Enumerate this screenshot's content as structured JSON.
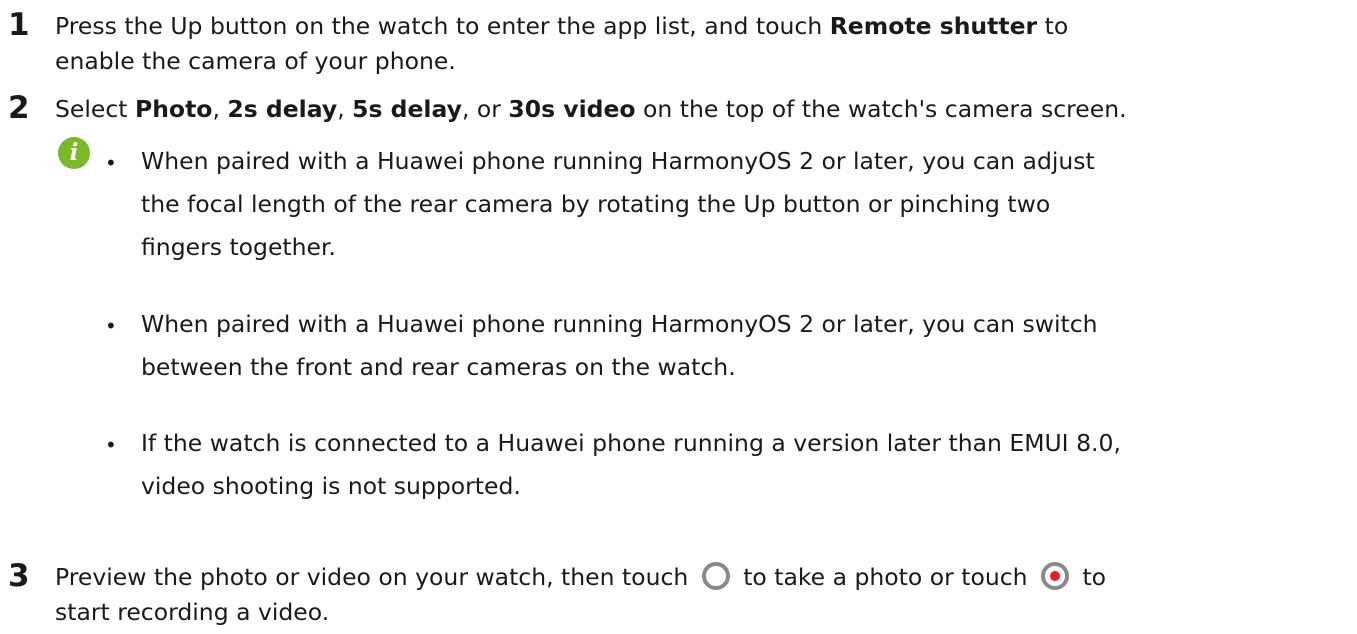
{
  "steps": [
    {
      "number": "1",
      "line1_a": "Press the Up button on the watch to enter the app list, and touch ",
      "line1_bold": "Remote shutter",
      "line1_b": " to",
      "line2": "enable the camera of your phone."
    },
    {
      "number": "2",
      "t1": "Select ",
      "b1": "Photo",
      "t2": ", ",
      "b2": "2s delay",
      "t3": ", ",
      "b3": "5s delay",
      "t4": ", or ",
      "b4": "30s video",
      "t5": " on the top of the watch's camera screen."
    },
    {
      "number": "3",
      "t1": "Preview the photo or video on your watch, then touch ",
      "t2": " to take a photo or touch ",
      "t3": " to",
      "line2": "start recording a video."
    }
  ],
  "note": {
    "icon_glyph": "i",
    "bullets": [
      {
        "line1": "When paired with a Huawei phone running HarmonyOS 2 or later, you can adjust",
        "line2": "the focal length of the rear camera by rotating the Up button or pinching two",
        "line3": "fingers together."
      },
      {
        "line1": "When paired with a Huawei phone running HarmonyOS 2 or later, you can switch",
        "line2": "between the front and rear cameras on the watch."
      },
      {
        "line1": "If the watch is connected to a Huawei phone running a version later than EMUI 8.0,",
        "line2": "video shooting is not supported."
      }
    ],
    "bullet_glyph": "•"
  },
  "icons": {
    "note": "info-icon",
    "shutter": "shutter-button-icon",
    "record": "record-button-icon",
    "note_color": "#7ab92a",
    "record_color": "#e0202a"
  }
}
